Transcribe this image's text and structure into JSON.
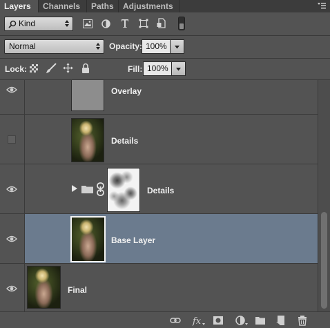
{
  "tabs": [
    {
      "label": "Layers",
      "active": true
    },
    {
      "label": "Channels",
      "active": false
    },
    {
      "label": "Paths",
      "active": false
    },
    {
      "label": "Adjustments",
      "active": false
    }
  ],
  "filter": {
    "kind_label": "Kind",
    "filter_icons": [
      "image-filter-icon",
      "adjustment-filter-icon",
      "type-filter-icon",
      "shape-filter-icon",
      "smart-object-filter-icon",
      "filter-toggle-icon"
    ]
  },
  "blend": {
    "mode": "Normal",
    "opacity_label": "Opacity:",
    "opacity_value": "100%"
  },
  "lock": {
    "label": "Lock:",
    "icons": [
      "lock-transparent-icon",
      "lock-image-pixels-icon",
      "lock-position-icon",
      "lock-all-icon"
    ],
    "fill_label": "Fill:",
    "fill_value": "100%"
  },
  "layers": [
    {
      "name": "Overlay",
      "visible": true,
      "selected": false,
      "thumbnail": "gray-fill"
    },
    {
      "name": "Details",
      "visible": false,
      "selected": false,
      "thumbnail": "portrait"
    },
    {
      "name": "Details",
      "visible": true,
      "selected": false,
      "thumbnail": "mask",
      "is_group": true
    },
    {
      "name": "Base Layer",
      "visible": true,
      "selected": true,
      "thumbnail": "portrait"
    },
    {
      "name": "Final",
      "visible": true,
      "selected": false,
      "thumbnail": "portrait"
    }
  ],
  "footer_icons": [
    "link-layers-icon",
    "fx-icon",
    "add-mask-icon",
    "adjustment-layer-icon",
    "new-group-icon",
    "new-layer-icon",
    "delete-icon"
  ],
  "colors": {
    "panel_bg": "#535353",
    "selected_row": "#6b7b8e",
    "tab_bar": "#3c3c3c"
  }
}
